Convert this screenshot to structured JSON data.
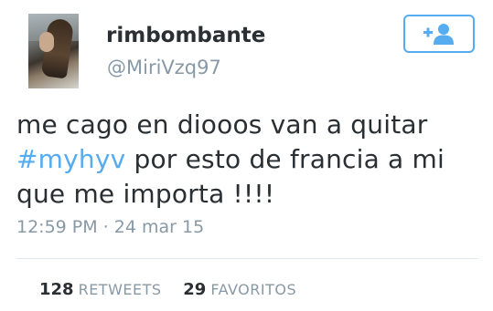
{
  "user": {
    "display_name": "rimbombante",
    "handle": "@MiriVzq97"
  },
  "follow_button": {
    "icon": "add-user-icon",
    "color": "#55acee"
  },
  "tweet": {
    "line1": "me cago en diooos van a quitar",
    "hashtag": "#myhyv",
    "line2_rest": " por esto de francia a mi",
    "line3": "que me importa !!!!",
    "timestamp": "12:59 PM · 24 mar 15"
  },
  "stats": {
    "retweets_count": "128",
    "retweets_label": "RETWEETS",
    "favorites_count": "29",
    "favorites_label": "FAVORITOS"
  },
  "colors": {
    "text": "#292f33",
    "muted": "#8899a6",
    "link": "#55acee"
  }
}
